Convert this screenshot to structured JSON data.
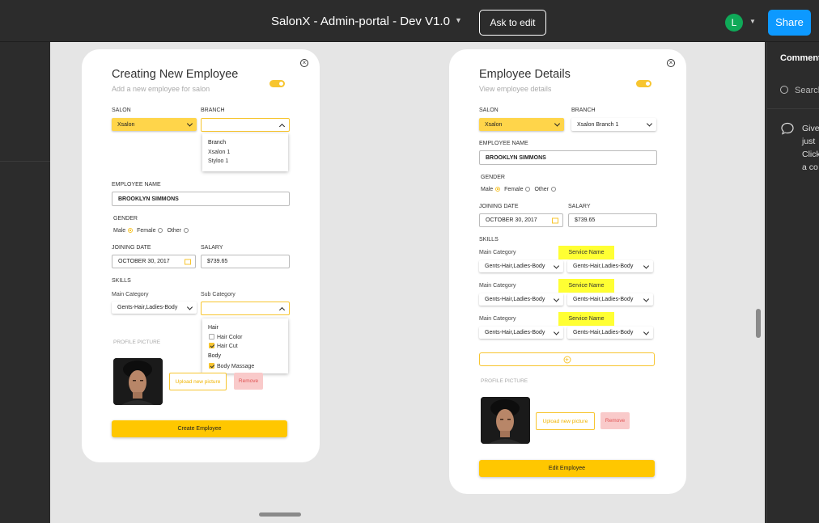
{
  "header": {
    "title": "SalonX - Admin-portal - Dev V1.0",
    "ask_to_edit": "Ask to edit",
    "avatar_initial": "L",
    "share": "Share"
  },
  "comments_panel": {
    "title": "Comments",
    "search_placeholder": "Search",
    "hint_lines": [
      "Give",
      "just",
      "Click",
      "a co"
    ]
  },
  "create_card": {
    "title": "Creating New Employee",
    "subtitle": "Add a new employee for salon",
    "toggle_on": true,
    "salon_label": "SALON",
    "salon_value": "Xsalon",
    "branch_label": "BRANCH",
    "branch_value": "",
    "branch_dropdown": {
      "header": "Branch",
      "options": [
        "Xsalon 1",
        "Styloo 1"
      ]
    },
    "employee_name_label": "EMPLOYEE NAME",
    "employee_name_value": "BROOKLYN SIMMONS",
    "gender_label": "GENDER",
    "gender_options": [
      "Male",
      "Female",
      "Other"
    ],
    "gender_selected": "Male",
    "joining_date_label": "JOINING DATE",
    "joining_date_value": "OCTOBER 30, 2017",
    "salary_label": "SALARY",
    "salary_value": "$739.65",
    "skills_label": "SKILLS",
    "main_category_label": "Main Category",
    "main_category_value": "Gents-Hair,Ladies-Body",
    "sub_category_label": "Sub Category",
    "sub_category_value": "",
    "sub_dropdown": {
      "groups": [
        {
          "name": "Hair",
          "items": [
            {
              "label": "Hair Color",
              "checked": false
            },
            {
              "label": "Hair Cut",
              "checked": true
            }
          ]
        },
        {
          "name": "Body",
          "items": [
            {
              "label": "Body Massage",
              "checked": true
            }
          ]
        }
      ]
    },
    "profile_picture_label": "PROFILE PICTURE",
    "upload_label": "Upload new picture",
    "remove_label": "Remove",
    "submit_label": "Create Employee"
  },
  "details_card": {
    "title": "Employee Details",
    "subtitle": "View employee details",
    "toggle_on": true,
    "salon_label": "SALON",
    "salon_value": "Xsalon",
    "branch_label": "BRANCH",
    "branch_value": "Xsalon Branch 1",
    "employee_name_label": "EMPLOYEE NAME",
    "employee_name_value": "BROOKLYN SIMMONS",
    "gender_label": "GENDER",
    "gender_options": [
      "Male",
      "Female",
      "Other"
    ],
    "gender_selected": "Male",
    "joining_date_label": "JOINING DATE",
    "joining_date_value": "OCTOBER 30, 2017",
    "salary_label": "SALARY",
    "salary_value": "$739.65",
    "skills_label": "SKILLS",
    "skill_rows": [
      {
        "main_label": "Main Category",
        "service_label": "Service Name",
        "main_value": "Gents-Hair,Ladies-Body",
        "service_value": "Gents-Hair,Ladies-Body"
      },
      {
        "main_label": "Main Category",
        "service_label": "Service Name",
        "main_value": "Gents-Hair,Ladies-Body",
        "service_value": "Gents-Hair,Ladies-Body"
      },
      {
        "main_label": "Main Category",
        "service_label": "Service Name",
        "main_value": "Gents-Hair,Ladies-Body",
        "service_value": "Gents-Hair,Ladies-Body"
      }
    ],
    "profile_picture_label": "PROFILE PICTURE",
    "upload_label": "Upload new picture",
    "remove_label": "Remove",
    "submit_label": "Edit Employee"
  },
  "colors": {
    "accent": "#ffc700",
    "share_blue": "#0d99ff",
    "avatar_green": "#0fa958",
    "highlight": "#ffff33"
  }
}
